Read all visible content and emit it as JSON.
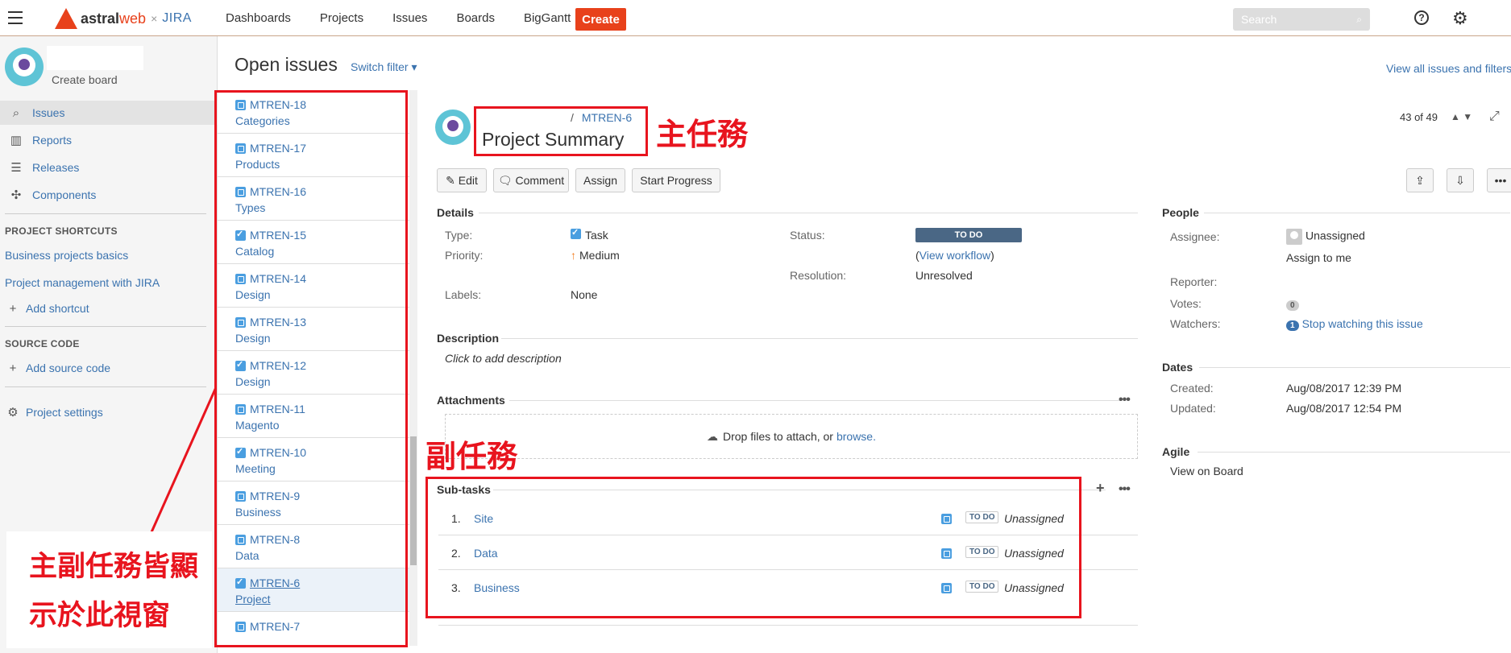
{
  "topnav": {
    "brand_a": "astral",
    "brand_b": "web",
    "times": "×",
    "jira": "JIRA",
    "links": [
      "Dashboards",
      "Projects",
      "Issues",
      "Boards",
      "BigGantt"
    ],
    "create": "Create",
    "search_placeholder": "Search",
    "help": "?"
  },
  "sidebar": {
    "create_board": "Create board",
    "items": [
      {
        "label": "Issues",
        "icon": "issues-icon",
        "active": true
      },
      {
        "label": "Reports",
        "icon": "reports-icon"
      },
      {
        "label": "Releases",
        "icon": "releases-icon"
      },
      {
        "label": "Components",
        "icon": "components-icon"
      }
    ],
    "shortcuts_head": "PROJECT SHORTCUTS",
    "shortcuts": [
      "Business projects basics",
      "Project management with JIRA"
    ],
    "add_shortcut": "Add shortcut",
    "source_head": "SOURCE CODE",
    "add_source": "Add source code",
    "settings": "Project settings"
  },
  "issues_header": {
    "title": "Open issues",
    "switch_filter": "Switch filter ▾",
    "view_all": "View all issues and filters"
  },
  "issue_list": [
    {
      "key": "MTREN-18",
      "summary": "Categories",
      "type": "sub"
    },
    {
      "key": "MTREN-17",
      "summary": "Products",
      "type": "sub"
    },
    {
      "key": "MTREN-16",
      "summary": "Types",
      "type": "sub"
    },
    {
      "key": "MTREN-15",
      "summary": "Catalog",
      "type": "task"
    },
    {
      "key": "MTREN-14",
      "summary": "Design",
      "type": "sub"
    },
    {
      "key": "MTREN-13",
      "summary": "Design",
      "type": "sub"
    },
    {
      "key": "MTREN-12",
      "summary": "Design",
      "type": "task"
    },
    {
      "key": "MTREN-11",
      "summary": "Magento",
      "type": "sub"
    },
    {
      "key": "MTREN-10",
      "summary": "Meeting",
      "type": "task"
    },
    {
      "key": "MTREN-9",
      "summary": "Business",
      "type": "sub"
    },
    {
      "key": "MTREN-8",
      "summary": "Data",
      "type": "sub"
    },
    {
      "key": "MTREN-6",
      "summary": "Project",
      "type": "task",
      "selected": true
    },
    {
      "key": "MTREN-7",
      "summary": "",
      "type": "sub"
    }
  ],
  "detail": {
    "crumb_sep": "/",
    "crumb_key": "MTREN-6",
    "title": "Project Summary",
    "counter": "43 of 49",
    "buttons": {
      "edit": "Edit",
      "comment": "Comment",
      "assign": "Assign",
      "start": "Start Progress"
    },
    "details_title": "Details",
    "type_label": "Type:",
    "type_value": "Task",
    "priority_label": "Priority:",
    "priority_value": "Medium",
    "labels_label": "Labels:",
    "labels_value": "None",
    "status_label": "Status:",
    "status_value": "TO DO",
    "workflow_open": "(",
    "workflow_link": "View workflow",
    "workflow_close": ")",
    "resolution_label": "Resolution:",
    "resolution_value": "Unresolved",
    "description_title": "Description",
    "description_placeholder": "Click to add description",
    "attachments_title": "Attachments",
    "drop_text": "Drop files to attach, or ",
    "browse": "browse.",
    "subtasks_title": "Sub-tasks",
    "subtasks": [
      {
        "num": "1.",
        "name": "Site",
        "status": "TO DO",
        "assignee": "Unassigned"
      },
      {
        "num": "2.",
        "name": "Data",
        "status": "TO DO",
        "assignee": "Unassigned"
      },
      {
        "num": "3.",
        "name": "Business",
        "status": "TO DO",
        "assignee": "Unassigned"
      }
    ]
  },
  "people": {
    "title": "People",
    "assignee_label": "Assignee:",
    "assignee_value": "Unassigned",
    "assign_to_me": "Assign to me",
    "reporter_label": "Reporter:",
    "votes_label": "Votes:",
    "votes_value": "0",
    "watchers_label": "Watchers:",
    "watchers_count": "1",
    "stop_watching": "Stop watching this issue",
    "dates_title": "Dates",
    "created_label": "Created:",
    "created_value": "Aug/08/2017 12:39 PM",
    "updated_label": "Updated:",
    "updated_value": "Aug/08/2017 12:54 PM",
    "agile_title": "Agile",
    "view_on_board": "View on Board"
  },
  "annotations": {
    "main_task": "主任務",
    "sub_task": "副任務",
    "window_note_1": "主副任務皆顯",
    "window_note_2": "示於此視窗",
    "color": "#e8141e"
  }
}
